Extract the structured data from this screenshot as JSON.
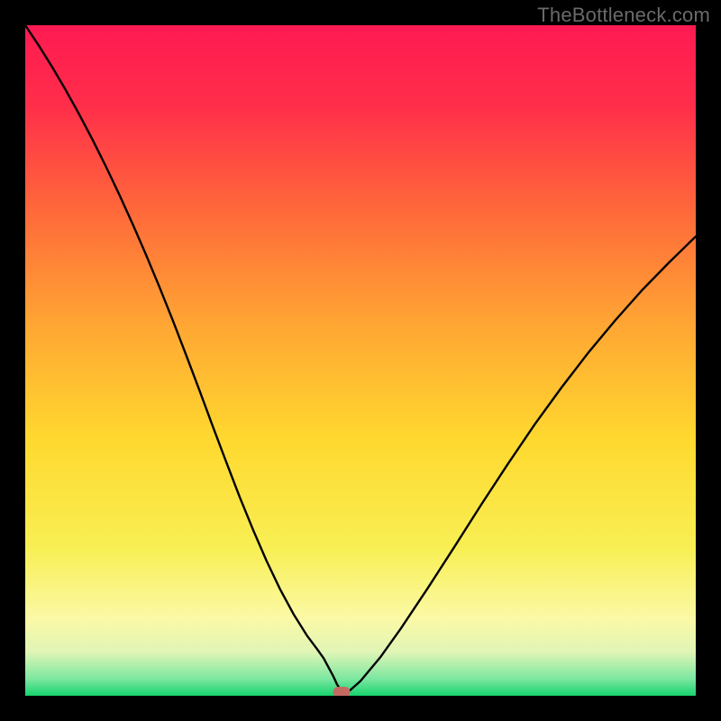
{
  "watermark": "TheBottleneck.com",
  "chart_data": {
    "type": "line",
    "title": "",
    "xlabel": "",
    "ylabel": "",
    "xlim": [
      0,
      100
    ],
    "ylim": [
      0,
      100
    ],
    "grid": false,
    "legend": false,
    "background": {
      "type": "vertical_gradient",
      "stops": [
        {
          "pos": 0.0,
          "color": "#ff1a52"
        },
        {
          "pos": 0.12,
          "color": "#ff2e4a"
        },
        {
          "pos": 0.28,
          "color": "#ff6a3a"
        },
        {
          "pos": 0.45,
          "color": "#ffa733"
        },
        {
          "pos": 0.62,
          "color": "#ffd92f"
        },
        {
          "pos": 0.78,
          "color": "#f8ef54"
        },
        {
          "pos": 0.885,
          "color": "#fbf9a6"
        },
        {
          "pos": 0.935,
          "color": "#e0f5b6"
        },
        {
          "pos": 0.975,
          "color": "#7BE7A0"
        },
        {
          "pos": 1.0,
          "color": "#16d36d"
        }
      ]
    },
    "series": [
      {
        "name": "bottleneck-curve",
        "color": "#000000",
        "stroke_width": 2.4,
        "x": [
          0.0,
          2,
          4,
          6,
          8,
          10,
          12,
          14,
          16,
          18,
          20,
          22,
          24,
          26,
          28,
          30,
          32,
          34,
          36,
          38,
          40,
          42,
          43.5,
          44.5,
          45.2,
          45.9,
          46.5,
          47.2,
          48.2,
          50,
          53,
          56,
          60,
          64,
          68,
          72,
          76,
          80,
          84,
          88,
          92,
          96,
          100
        ],
        "y": [
          100,
          97,
          93.8,
          90.4,
          86.8,
          83,
          79,
          74.8,
          70.4,
          65.8,
          61,
          56,
          50.8,
          45.5,
          40.1,
          34.8,
          29.6,
          24.7,
          20.1,
          15.9,
          12.2,
          9.0,
          7.0,
          5.6,
          4.3,
          3.0,
          1.7,
          0.6,
          0.6,
          2.2,
          5.8,
          10.0,
          16.0,
          22.2,
          28.5,
          34.6,
          40.5,
          46.0,
          51.2,
          56.0,
          60.5,
          64.6,
          68.5
        ]
      }
    ],
    "annotations": [
      {
        "name": "min-marker",
        "shape": "ellipse",
        "x": 47.2,
        "y": 0.5,
        "color": "#c56a63"
      }
    ]
  }
}
